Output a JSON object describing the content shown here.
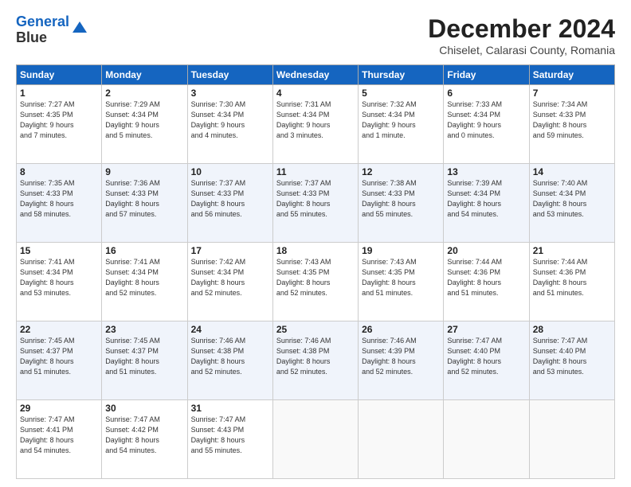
{
  "header": {
    "logo_line1": "General",
    "logo_line2": "Blue",
    "title": "December 2024",
    "subtitle": "Chiselet, Calarasi County, Romania"
  },
  "days_of_week": [
    "Sunday",
    "Monday",
    "Tuesday",
    "Wednesday",
    "Thursday",
    "Friday",
    "Saturday"
  ],
  "weeks": [
    [
      {
        "day": "1",
        "info": "Sunrise: 7:27 AM\nSunset: 4:35 PM\nDaylight: 9 hours\nand 7 minutes."
      },
      {
        "day": "2",
        "info": "Sunrise: 7:29 AM\nSunset: 4:34 PM\nDaylight: 9 hours\nand 5 minutes."
      },
      {
        "day": "3",
        "info": "Sunrise: 7:30 AM\nSunset: 4:34 PM\nDaylight: 9 hours\nand 4 minutes."
      },
      {
        "day": "4",
        "info": "Sunrise: 7:31 AM\nSunset: 4:34 PM\nDaylight: 9 hours\nand 3 minutes."
      },
      {
        "day": "5",
        "info": "Sunrise: 7:32 AM\nSunset: 4:34 PM\nDaylight: 9 hours\nand 1 minute."
      },
      {
        "day": "6",
        "info": "Sunrise: 7:33 AM\nSunset: 4:34 PM\nDaylight: 9 hours\nand 0 minutes."
      },
      {
        "day": "7",
        "info": "Sunrise: 7:34 AM\nSunset: 4:33 PM\nDaylight: 8 hours\nand 59 minutes."
      }
    ],
    [
      {
        "day": "8",
        "info": "Sunrise: 7:35 AM\nSunset: 4:33 PM\nDaylight: 8 hours\nand 58 minutes."
      },
      {
        "day": "9",
        "info": "Sunrise: 7:36 AM\nSunset: 4:33 PM\nDaylight: 8 hours\nand 57 minutes."
      },
      {
        "day": "10",
        "info": "Sunrise: 7:37 AM\nSunset: 4:33 PM\nDaylight: 8 hours\nand 56 minutes."
      },
      {
        "day": "11",
        "info": "Sunrise: 7:37 AM\nSunset: 4:33 PM\nDaylight: 8 hours\nand 55 minutes."
      },
      {
        "day": "12",
        "info": "Sunrise: 7:38 AM\nSunset: 4:33 PM\nDaylight: 8 hours\nand 55 minutes."
      },
      {
        "day": "13",
        "info": "Sunrise: 7:39 AM\nSunset: 4:34 PM\nDaylight: 8 hours\nand 54 minutes."
      },
      {
        "day": "14",
        "info": "Sunrise: 7:40 AM\nSunset: 4:34 PM\nDaylight: 8 hours\nand 53 minutes."
      }
    ],
    [
      {
        "day": "15",
        "info": "Sunrise: 7:41 AM\nSunset: 4:34 PM\nDaylight: 8 hours\nand 53 minutes."
      },
      {
        "day": "16",
        "info": "Sunrise: 7:41 AM\nSunset: 4:34 PM\nDaylight: 8 hours\nand 52 minutes."
      },
      {
        "day": "17",
        "info": "Sunrise: 7:42 AM\nSunset: 4:34 PM\nDaylight: 8 hours\nand 52 minutes."
      },
      {
        "day": "18",
        "info": "Sunrise: 7:43 AM\nSunset: 4:35 PM\nDaylight: 8 hours\nand 52 minutes."
      },
      {
        "day": "19",
        "info": "Sunrise: 7:43 AM\nSunset: 4:35 PM\nDaylight: 8 hours\nand 51 minutes."
      },
      {
        "day": "20",
        "info": "Sunrise: 7:44 AM\nSunset: 4:36 PM\nDaylight: 8 hours\nand 51 minutes."
      },
      {
        "day": "21",
        "info": "Sunrise: 7:44 AM\nSunset: 4:36 PM\nDaylight: 8 hours\nand 51 minutes."
      }
    ],
    [
      {
        "day": "22",
        "info": "Sunrise: 7:45 AM\nSunset: 4:37 PM\nDaylight: 8 hours\nand 51 minutes."
      },
      {
        "day": "23",
        "info": "Sunrise: 7:45 AM\nSunset: 4:37 PM\nDaylight: 8 hours\nand 51 minutes."
      },
      {
        "day": "24",
        "info": "Sunrise: 7:46 AM\nSunset: 4:38 PM\nDaylight: 8 hours\nand 52 minutes."
      },
      {
        "day": "25",
        "info": "Sunrise: 7:46 AM\nSunset: 4:38 PM\nDaylight: 8 hours\nand 52 minutes."
      },
      {
        "day": "26",
        "info": "Sunrise: 7:46 AM\nSunset: 4:39 PM\nDaylight: 8 hours\nand 52 minutes."
      },
      {
        "day": "27",
        "info": "Sunrise: 7:47 AM\nSunset: 4:40 PM\nDaylight: 8 hours\nand 52 minutes."
      },
      {
        "day": "28",
        "info": "Sunrise: 7:47 AM\nSunset: 4:40 PM\nDaylight: 8 hours\nand 53 minutes."
      }
    ],
    [
      {
        "day": "29",
        "info": "Sunrise: 7:47 AM\nSunset: 4:41 PM\nDaylight: 8 hours\nand 54 minutes."
      },
      {
        "day": "30",
        "info": "Sunrise: 7:47 AM\nSunset: 4:42 PM\nDaylight: 8 hours\nand 54 minutes."
      },
      {
        "day": "31",
        "info": "Sunrise: 7:47 AM\nSunset: 4:43 PM\nDaylight: 8 hours\nand 55 minutes."
      },
      {
        "day": "",
        "info": ""
      },
      {
        "day": "",
        "info": ""
      },
      {
        "day": "",
        "info": ""
      },
      {
        "day": "",
        "info": ""
      }
    ]
  ]
}
